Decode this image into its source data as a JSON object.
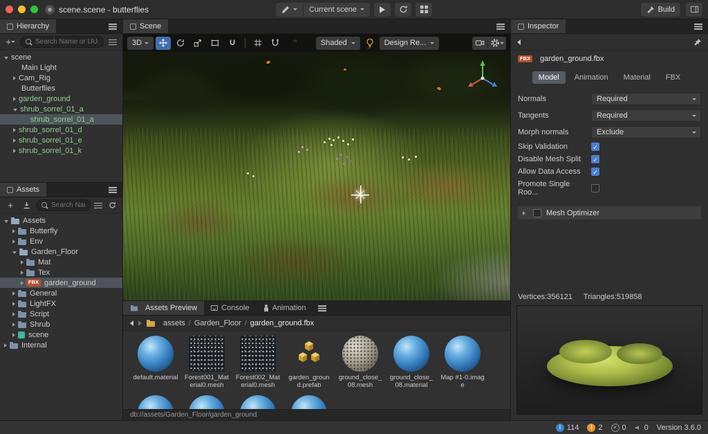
{
  "colors": {
    "accent": "#3f6fae",
    "prefab_green": "#8fd18f",
    "warning_orange": "#e09a2a",
    "info_blue": "#3b82d0",
    "fbx_badge": "#b5502d"
  },
  "titlebar": {
    "app_title": "scene.scene - butterflies",
    "scene_select": "Current scene",
    "build_label": "Build"
  },
  "hierarchy": {
    "title": "Hierarchy",
    "search_placeholder": "Search Name or UUID",
    "items": [
      {
        "label": "scene",
        "indent": 0,
        "arrow": "open"
      },
      {
        "label": "Main Light",
        "indent": 1,
        "arrow": "none"
      },
      {
        "label": "Cam_Rig",
        "indent": 1,
        "arrow": "closed"
      },
      {
        "label": "Butterflies",
        "indent": 1,
        "arrow": "none"
      },
      {
        "label": "garden_ground",
        "indent": 1,
        "arrow": "closed",
        "color": "green"
      },
      {
        "label": "shrub_sorrel_01_a",
        "indent": 1,
        "arrow": "open",
        "color": "green"
      },
      {
        "label": "shrub_sorrel_01_a",
        "indent": 2,
        "arrow": "none",
        "color": "green",
        "selected": true
      },
      {
        "label": "shrub_sorrel_01_d",
        "indent": 1,
        "arrow": "closed",
        "color": "green"
      },
      {
        "label": "shrub_sorrel_01_e",
        "indent": 1,
        "arrow": "closed",
        "color": "green"
      },
      {
        "label": "shrub_sorrel_01_k",
        "indent": 1,
        "arrow": "closed",
        "color": "green"
      }
    ]
  },
  "assets": {
    "title": "Assets",
    "search_placeholder": "Search Name o",
    "items": [
      {
        "label": "Assets",
        "indent": 0,
        "arrow": "open",
        "icon": "folder-open"
      },
      {
        "label": "Butterfly",
        "indent": 1,
        "arrow": "closed",
        "icon": "folder"
      },
      {
        "label": "Env",
        "indent": 1,
        "arrow": "closed",
        "icon": "folder"
      },
      {
        "label": "Garden_Floor",
        "indent": 1,
        "arrow": "open",
        "icon": "folder-open"
      },
      {
        "label": "Mat",
        "indent": 2,
        "arrow": "closed",
        "icon": "folder"
      },
      {
        "label": "Tex",
        "indent": 2,
        "arrow": "closed",
        "icon": "folder"
      },
      {
        "label": "garden_ground",
        "indent": 2,
        "arrow": "closed",
        "icon": "fbx",
        "badge": "FBX",
        "selected": true
      },
      {
        "label": "General",
        "indent": 1,
        "arrow": "closed",
        "icon": "folder"
      },
      {
        "label": "LightFX",
        "indent": 1,
        "arrow": "closed",
        "icon": "folder"
      },
      {
        "label": "Script",
        "indent": 1,
        "arrow": "closed",
        "icon": "folder"
      },
      {
        "label": "Shrub",
        "indent": 1,
        "arrow": "closed",
        "icon": "folder"
      },
      {
        "label": "scene",
        "indent": 1,
        "arrow": "closed",
        "icon": "scene"
      },
      {
        "label": "Internal",
        "indent": 0,
        "arrow": "closed",
        "icon": "folder"
      }
    ]
  },
  "viewport": {
    "scene_tab": "Scene",
    "mode_label": "3D",
    "shading_value": "Shaded",
    "design_value": "Design Re..."
  },
  "preview_panel": {
    "tabs": [
      {
        "label": "Assets Preview",
        "icon": "folder",
        "selected": true
      },
      {
        "label": "Console",
        "icon": "console"
      },
      {
        "label": "Animation",
        "icon": "person"
      }
    ],
    "breadcrumb": {
      "root": "assets",
      "folder": "Garden_Floor",
      "file": "garden_ground.fbx"
    },
    "thumbnails": [
      {
        "name": "default.material",
        "type": "material"
      },
      {
        "name": "Forest001_Material0.mesh",
        "type": "mesh"
      },
      {
        "name": "Forest002_Material0.mesh",
        "type": "mesh"
      },
      {
        "name": "garden_ground.prefab",
        "type": "prefab"
      },
      {
        "name": "ground_close_08.mesh",
        "type": "sphere"
      },
      {
        "name": "ground_close_08.material",
        "type": "material"
      },
      {
        "name": "Map #1-0.image",
        "type": "image"
      }
    ],
    "partial_row_types": [
      "material",
      "material",
      "material",
      "material"
    ],
    "db_path": "db://assets/Garden_Floor/garden_ground"
  },
  "inspector": {
    "title": "Inspector",
    "file_badge": "FBX",
    "file_name": "garden_ground.fbx",
    "tabs": [
      {
        "label": "Model",
        "selected": true
      },
      {
        "label": "Animation"
      },
      {
        "label": "Material"
      },
      {
        "label": "FBX"
      }
    ],
    "dropdowns": [
      {
        "label": "Normals",
        "value": "Required"
      },
      {
        "label": "Tangents",
        "value": "Required"
      },
      {
        "label": "Morph normals",
        "value": "Exclude"
      }
    ],
    "checkboxes": [
      {
        "label": "Skip Validation",
        "checked": true
      },
      {
        "label": "Disable Mesh Split",
        "checked": true
      },
      {
        "label": "Allow Data Access",
        "checked": true
      },
      {
        "label": "Promote Single Roo...",
        "checked": false
      }
    ],
    "section_label": "Mesh Optimizer",
    "vertices": "Vertices:356121",
    "triangles": "Triangles:519858"
  },
  "statusbar": {
    "info_count": "114",
    "warning_count": "2",
    "error_count": "0",
    "notice_count": "0",
    "version": "Version 3.6.0"
  }
}
